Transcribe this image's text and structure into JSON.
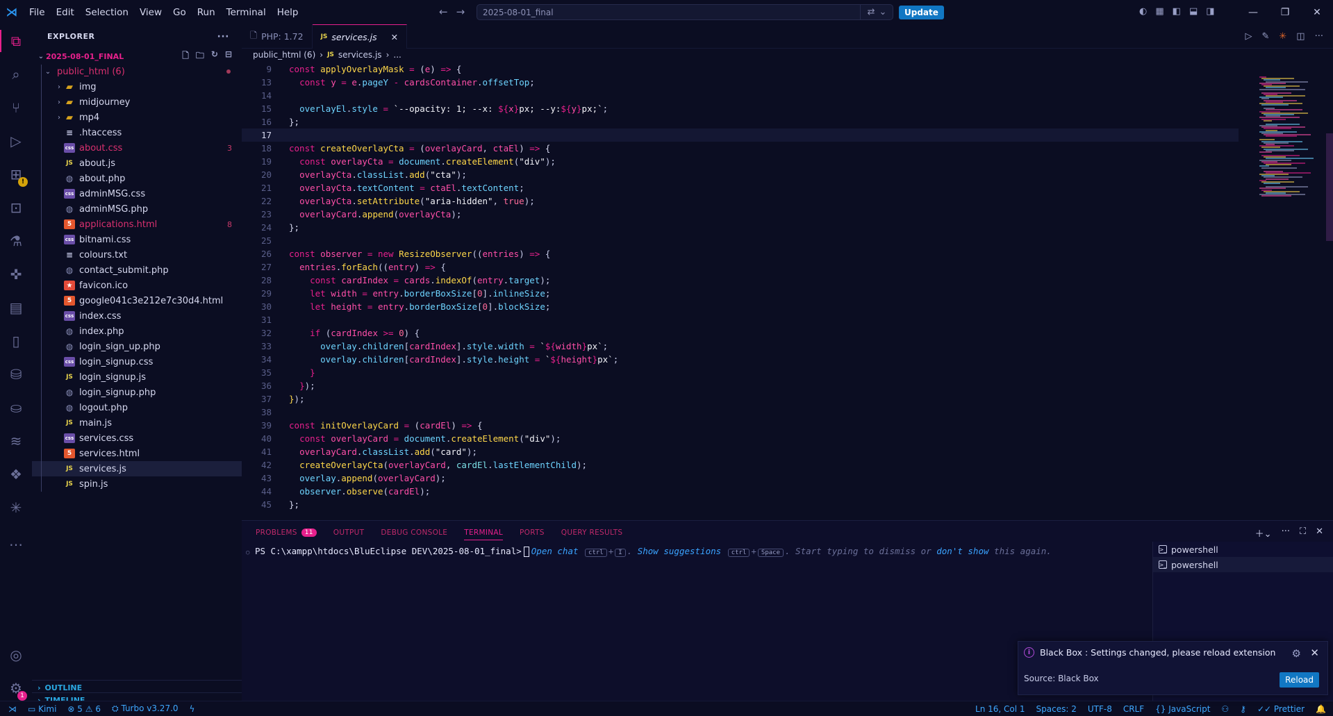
{
  "titlebar": {
    "menu": [
      "File",
      "Edit",
      "Selection",
      "View",
      "Go",
      "Run",
      "Terminal",
      "Help"
    ],
    "search_text": "2025-08-01_final",
    "update_label": "Update"
  },
  "explorer": {
    "title": "EXPLORER",
    "root": "2025-08-01_FINAL",
    "folder": "public_html (6)",
    "items": [
      {
        "name": "img",
        "type": "folder",
        "chev": "›"
      },
      {
        "name": "midjourney",
        "type": "folder",
        "chev": "›"
      },
      {
        "name": "mp4",
        "type": "folder",
        "chev": "›"
      },
      {
        "name": ".htaccess",
        "type": "txt"
      },
      {
        "name": "about.css",
        "type": "css",
        "errors": "3"
      },
      {
        "name": "about.js",
        "type": "js"
      },
      {
        "name": "about.php",
        "type": "php"
      },
      {
        "name": "adminMSG.css",
        "type": "css"
      },
      {
        "name": "adminMSG.php",
        "type": "php"
      },
      {
        "name": "applications.html",
        "type": "html",
        "errors": "8"
      },
      {
        "name": "bitnami.css",
        "type": "css"
      },
      {
        "name": "colours.txt",
        "type": "txt"
      },
      {
        "name": "contact_submit.php",
        "type": "php"
      },
      {
        "name": "favicon.ico",
        "type": "ico"
      },
      {
        "name": "google041c3e212e7c30d4.html",
        "type": "html"
      },
      {
        "name": "index.css",
        "type": "css"
      },
      {
        "name": "index.php",
        "type": "php"
      },
      {
        "name": "login_sign_up.php",
        "type": "php"
      },
      {
        "name": "login_signup.css",
        "type": "css"
      },
      {
        "name": "login_signup.js",
        "type": "js"
      },
      {
        "name": "login_signup.php",
        "type": "php"
      },
      {
        "name": "logout.php",
        "type": "php"
      },
      {
        "name": "main.js",
        "type": "js"
      },
      {
        "name": "services.css",
        "type": "css"
      },
      {
        "name": "services.html",
        "type": "html"
      },
      {
        "name": "services.js",
        "type": "js",
        "selected": true
      },
      {
        "name": "spin.js",
        "type": "js"
      }
    ],
    "outline": "OUTLINE",
    "timeline": "TIMELINE"
  },
  "tabs": [
    {
      "label": "PHP: 1.72"
    },
    {
      "label": "services.js",
      "active": true
    }
  ],
  "breadcrumb": {
    "folder": "public_html (6)",
    "file": "services.js",
    "tail": "..."
  },
  "code": {
    "current_line": "16",
    "sticky_line": "9",
    "lines": [
      {
        "n": "9"
      },
      {
        "n": "13"
      },
      {
        "n": "14"
      },
      {
        "n": "15"
      },
      {
        "n": "16"
      },
      {
        "n": "17"
      },
      {
        "n": "18"
      },
      {
        "n": "19"
      },
      {
        "n": "20"
      },
      {
        "n": "21"
      },
      {
        "n": "22"
      },
      {
        "n": "23"
      },
      {
        "n": "24"
      },
      {
        "n": "25"
      },
      {
        "n": "26"
      },
      {
        "n": "27"
      },
      {
        "n": "28"
      },
      {
        "n": "29"
      },
      {
        "n": "30"
      },
      {
        "n": "31"
      },
      {
        "n": "32"
      },
      {
        "n": "33"
      },
      {
        "n": "34"
      },
      {
        "n": "35"
      },
      {
        "n": "36"
      },
      {
        "n": "37"
      },
      {
        "n": "38"
      },
      {
        "n": "39"
      },
      {
        "n": "40"
      },
      {
        "n": "41"
      },
      {
        "n": "42"
      },
      {
        "n": "43"
      },
      {
        "n": "44"
      },
      {
        "n": "45"
      }
    ]
  },
  "panel": {
    "tabs": {
      "problems": "PROBLEMS",
      "problems_count": "11",
      "output": "OUTPUT",
      "debug": "DEBUG CONSOLE",
      "terminal": "TERMINAL",
      "ports": "PORTS",
      "query": "QUERY RESULTS"
    },
    "terminal": {
      "prompt": "PS C:\\xampp\\htdocs\\BluEclipse DEV\\2025-08-01_final>",
      "open_chat": "Open chat",
      "kbd_ctrl": "ctrl",
      "kbd_i": "I",
      "show_suggestions": "Show suggestions",
      "kbd_space": "Space",
      "typing_hint": ". Start typing to dismiss or",
      "dont_show": "don't show",
      "again": "this again."
    },
    "terminals": [
      "powershell",
      "powershell"
    ]
  },
  "notification": {
    "message": "Black Box : Settings changed, please reload extension",
    "source": "Source: Black Box",
    "action": "Reload"
  },
  "statusbar": {
    "kimi": "Kimi",
    "errors": "5",
    "warnings": "6",
    "turbo": "Turbo v3.27.0",
    "position": "Ln 16, Col 1",
    "spaces": "Spaces: 2",
    "encoding": "UTF-8",
    "eol": "CRLF",
    "language": "JavaScript",
    "prettier": "Prettier"
  },
  "colors": {
    "accent": "#e7208c",
    "keyword": "#e7208c",
    "function": "#ffd84a",
    "property": "#6ed4ff",
    "background": "#0b0d22",
    "button": "#1177c3"
  }
}
